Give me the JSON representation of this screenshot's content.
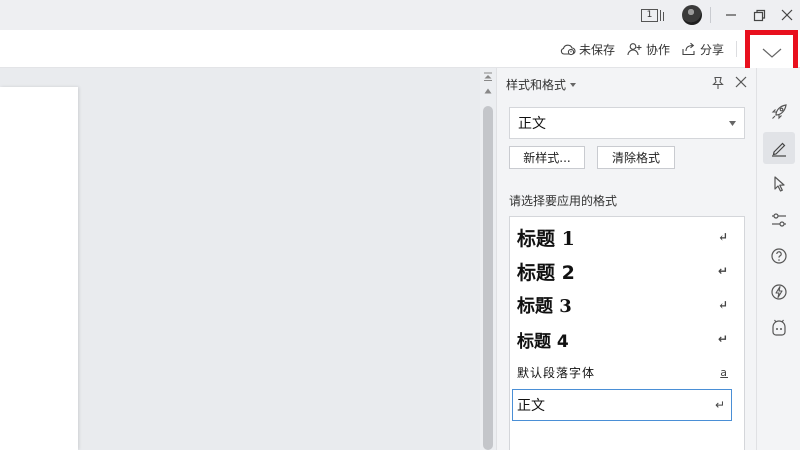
{
  "titlebar": {
    "page_indicator": "1",
    "window_controls": [
      "minimize-icon",
      "restore-icon",
      "close-icon"
    ]
  },
  "toolbar": {
    "unsaved_label": "未保存",
    "collab_label": "协作",
    "share_label": "分享",
    "collapse_icon": "chevron-down-icon"
  },
  "styles_panel": {
    "title": "样式和格式",
    "current_style": "正文",
    "new_style_button": "新样式...",
    "clear_format_button": "清除格式",
    "apply_label": "请选择要应用的格式",
    "styles": [
      {
        "label": "标题 1",
        "mark": "↵"
      },
      {
        "label": "标题 2",
        "mark": "↵"
      },
      {
        "label": "标题 3",
        "mark": "↵"
      },
      {
        "label": "标题 4",
        "mark": "↵"
      },
      {
        "label": "默认段落字体",
        "mark": "a"
      },
      {
        "label": "正文",
        "mark": "↵"
      }
    ],
    "selected_style_index": 5
  },
  "right_rail": {
    "icons": [
      "rocket-icon",
      "pen-icon",
      "pointer-icon",
      "sliders-icon",
      "help-icon",
      "lightning-icon",
      "bot-icon"
    ],
    "active_index": 1
  },
  "colors": {
    "highlight_red": "#e8101e",
    "selection_blue": "#4a8fd6"
  }
}
